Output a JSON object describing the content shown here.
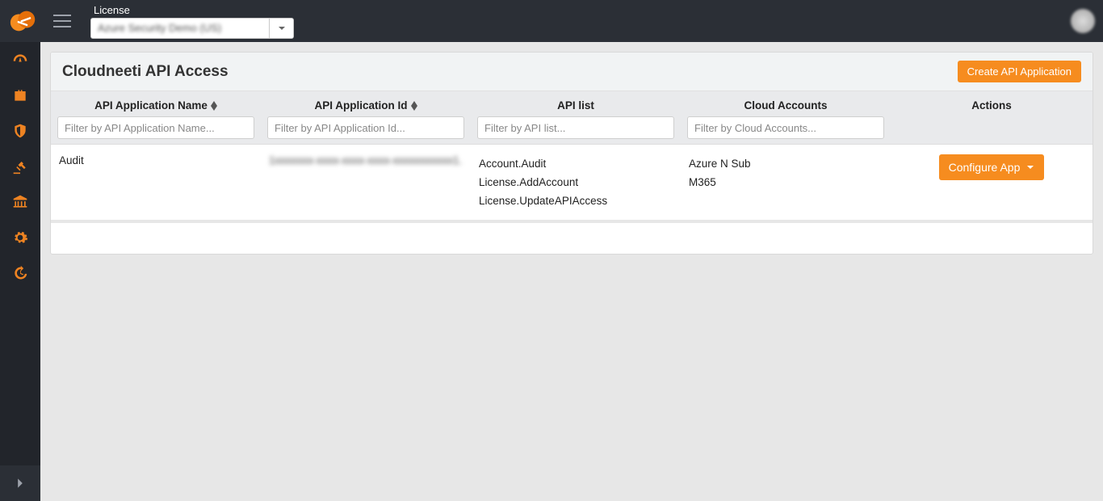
{
  "topbar": {
    "license_label": "License",
    "license_value": "Azure Security Demo (US)"
  },
  "page": {
    "title": "Cloudneeti API Access",
    "create_button": "Create API Application"
  },
  "table": {
    "headers": {
      "name": "API Application Name",
      "id": "API Application Id",
      "apis": "API list",
      "clouds": "Cloud Accounts",
      "actions": "Actions"
    },
    "filters": {
      "name_ph": "Filter by API Application Name...",
      "id_ph": "Filter by API Application Id...",
      "api_ph": "Filter by API list...",
      "cloud_ph": "Filter by Cloud Accounts..."
    },
    "rows": [
      {
        "name": "Audit",
        "id": "1xxxxxxx-xxxx-xxxx-xxxx-xxxxxxxxxxx1...",
        "apis": [
          "Account.Audit",
          "License.AddAccount",
          "License.UpdateAPIAccess"
        ],
        "clouds": [
          "Azure N Sub",
          "M365"
        ],
        "configure_label": "Configure App"
      }
    ]
  }
}
